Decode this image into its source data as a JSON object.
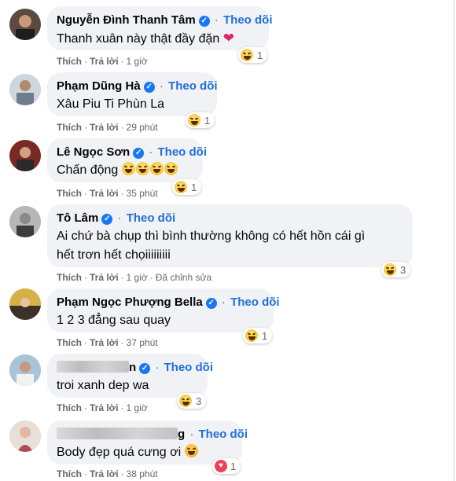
{
  "labels": {
    "follow": "Theo dõi",
    "like": "Thích",
    "reply": "Trả lời",
    "separator": "·"
  },
  "comments": [
    {
      "name": "Nguyễn Đình Thanh Tâm",
      "text": "Thanh xuân này thật đầy đặn",
      "time": "1 giờ",
      "reaction_count": "1"
    },
    {
      "name": "Phạm Dũng Hà",
      "text": "Xâu Piu Ti Phùn La",
      "time": "29 phút",
      "reaction_count": "1"
    },
    {
      "name": "Lê Ngọc Sơn",
      "text": "Chấn động",
      "time": "35 phút",
      "reaction_count": "1"
    },
    {
      "name": "Tô Lâm",
      "text_line1": "Ai chứ bà chụp thì bình thường không có hết hồn cái gì",
      "text_line2": "hết trơn hết chọiiiiiiiii",
      "time": "1 giờ",
      "edited": "Đã chỉnh sửa",
      "reaction_count": "3"
    },
    {
      "name": "Phạm Ngọc Phượng Bella",
      "text": "1 2 3 đẳng sau quay",
      "time": "37 phút",
      "reaction_count": "1"
    },
    {
      "name_visible": "n",
      "text": "troi xanh dep wa",
      "time": "1 giờ",
      "reaction_count": "3"
    },
    {
      "name_visible": "g",
      "text": "Body đẹp quá cưng ơi",
      "time": "38 phút",
      "reaction_count": "1"
    }
  ],
  "colors": {
    "follow": "#216fdb",
    "bubble": "#f0f2f5",
    "meta": "#65676b"
  }
}
